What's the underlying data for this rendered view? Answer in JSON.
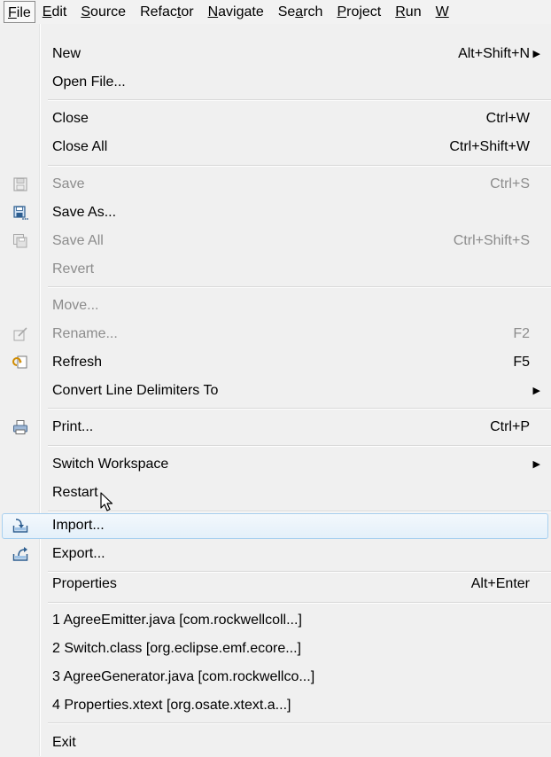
{
  "menubar": {
    "items": [
      {
        "pre": "",
        "u": "F",
        "post": "ile"
      },
      {
        "pre": "",
        "u": "E",
        "post": "dit"
      },
      {
        "pre": "",
        "u": "S",
        "post": "ource"
      },
      {
        "pre": "Refac",
        "u": "t",
        "post": "or"
      },
      {
        "pre": "",
        "u": "N",
        "post": "avigate"
      },
      {
        "pre": "Se",
        "u": "a",
        "post": "rch"
      },
      {
        "pre": "",
        "u": "P",
        "post": "roject"
      },
      {
        "pre": "",
        "u": "R",
        "post": "un"
      },
      {
        "pre": "",
        "u": "W",
        "post": ""
      }
    ]
  },
  "menu": {
    "new": {
      "label": "New",
      "accel": "Alt+Shift+N"
    },
    "open_file": {
      "label": "Open File..."
    },
    "close": {
      "label": "Close",
      "accel": "Ctrl+W"
    },
    "close_all": {
      "label": "Close All",
      "accel": "Ctrl+Shift+W"
    },
    "save": {
      "label": "Save",
      "accel": "Ctrl+S"
    },
    "save_as": {
      "label": "Save As..."
    },
    "save_all": {
      "label": "Save All",
      "accel": "Ctrl+Shift+S"
    },
    "revert": {
      "label": "Revert"
    },
    "move": {
      "label": "Move..."
    },
    "rename": {
      "label": "Rename...",
      "accel": "F2"
    },
    "refresh": {
      "label": "Refresh",
      "accel": "F5"
    },
    "convert": {
      "label": "Convert Line Delimiters To"
    },
    "print": {
      "label": "Print...",
      "accel": "Ctrl+P"
    },
    "switch_ws": {
      "label": "Switch Workspace"
    },
    "restart": {
      "label": "Restart"
    },
    "import": {
      "label": "Import..."
    },
    "export": {
      "label": "Export..."
    },
    "properties": {
      "label": "Properties",
      "accel": "Alt+Enter"
    },
    "recent": [
      "1 AgreeEmitter.java  [com.rockwellcoll...]",
      "2 Switch.class  [org.eclipse.emf.ecore...]",
      "3 AgreeGenerator.java  [com.rockwellco...]",
      "4 Properties.xtext  [org.osate.xtext.a...]"
    ],
    "exit": {
      "label": "Exit"
    }
  },
  "icons": {
    "save": "save-icon",
    "save_as": "save-as-icon",
    "save_all": "save-all-icon",
    "rename": "rename-icon",
    "refresh": "refresh-icon",
    "print": "print-icon",
    "import": "import-icon",
    "export": "export-icon"
  },
  "colors": {
    "menu_bg": "#f0f0f0",
    "disabled_text": "#8c8c8c",
    "hover_border": "#a8d0ef",
    "hover_fill": "#e4f0fa"
  }
}
